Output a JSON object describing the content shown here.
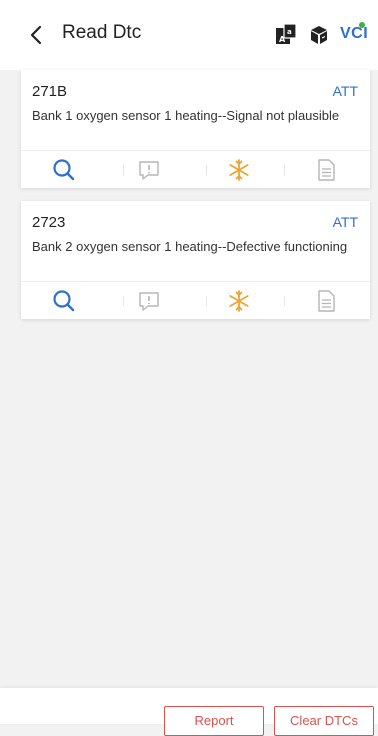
{
  "header": {
    "title": "Read Dtc",
    "vci_label": "VCI",
    "icons": [
      "back-chevron-icon",
      "language-icon",
      "package-icon",
      "vci-status-icon"
    ]
  },
  "dtcs": [
    {
      "code": "271B",
      "status": "ATT",
      "description": "Bank 1 oxygen sensor 1 heating--Signal not plausible"
    },
    {
      "code": "2723",
      "status": "ATT",
      "description": "Bank 2 oxygen sensor 1 heating--Defective functioning"
    }
  ],
  "footer": {
    "report_label": "Report",
    "clear_label": "Clear DTCs"
  },
  "colors": {
    "accent_blue": "#2f6fd0",
    "freeze_orange": "#f0a330",
    "button_red": "#d9534f",
    "icon_gray": "#b5b5b5"
  }
}
